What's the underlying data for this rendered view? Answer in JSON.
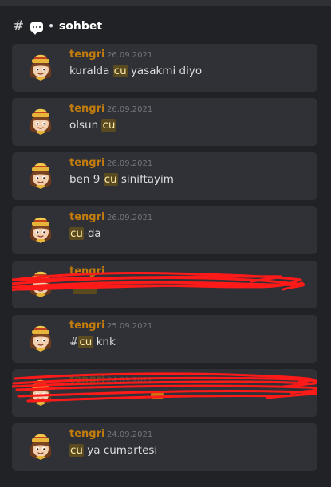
{
  "header": {
    "hash_symbol": "#",
    "channel_name": "sohbet"
  },
  "colors": {
    "background": "#202225",
    "card": "#2f3136",
    "username": "#c27c0e",
    "timestamp": "#72767d",
    "text": "#dcddde",
    "highlight": "#5a4a20",
    "scribble": "#ff0000"
  },
  "results": [
    {
      "author": "tengri",
      "date": "26.09.2021",
      "before": "kuralda ",
      "match": "cu",
      "after": " yasakmi diyo",
      "redacted": false
    },
    {
      "author": "tengri",
      "date": "26.09.2021",
      "before": "olsun ",
      "match": "cu",
      "after": "",
      "redacted": false
    },
    {
      "author": "tengri",
      "date": "26.09.2021",
      "before": "ben 9 ",
      "match": "cu",
      "after": " siniftayim",
      "redacted": false
    },
    {
      "author": "tengri",
      "date": "26.09.2021",
      "before": "",
      "match": "cu",
      "after": "-da",
      "redacted": false
    },
    {
      "author": "tengri",
      "date": "",
      "before": "",
      "match": "",
      "after": "",
      "redacted": true
    },
    {
      "author": "tengri",
      "date": "25.09.2021",
      "before": "#",
      "match": "cu",
      "after": " knk",
      "redacted": false
    },
    {
      "author": "tengri",
      "date": "24.09.2021",
      "before": "",
      "match": "",
      "after": "",
      "redacted": true
    },
    {
      "author": "tengri",
      "date": "24.09.2021",
      "before": "",
      "match": "cu",
      "after": " ya cumartesi",
      "redacted": false
    }
  ]
}
